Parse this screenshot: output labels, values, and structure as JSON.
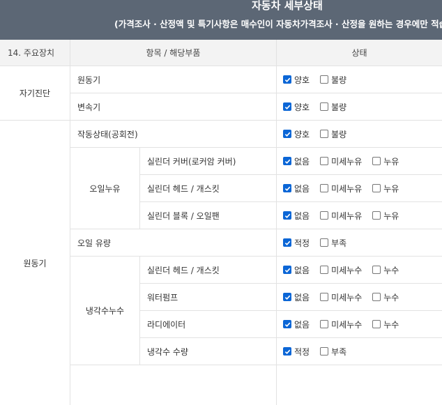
{
  "header": {
    "title": "자동차 세부상태",
    "subtitle": "(가격조사 · 산정액 및 특기사항은 매수인이 자동차가격조사 · 산정을 원하는 경우에만 적습니다"
  },
  "table": {
    "col_section": "14. 주요장치",
    "col_item": "항목 / 해당부품",
    "col_status": "상태",
    "categories": {
      "self_diag": "자기진단",
      "engine": "원동기"
    },
    "subgroups": {
      "oil_leak": "오일누유",
      "coolant_leak": "냉각수누수"
    },
    "rows": [
      {
        "label": "원동기",
        "options": [
          {
            "label": "양호",
            "checked": true
          },
          {
            "label": "불량",
            "checked": false
          }
        ]
      },
      {
        "label": "변속기",
        "options": [
          {
            "label": "양호",
            "checked": true
          },
          {
            "label": "불량",
            "checked": false
          }
        ]
      },
      {
        "label": "작동상태(공회전)",
        "options": [
          {
            "label": "양호",
            "checked": true
          },
          {
            "label": "불량",
            "checked": false
          }
        ]
      },
      {
        "label": "실린더 커버(로커암 커버)",
        "options": [
          {
            "label": "없음",
            "checked": true
          },
          {
            "label": "미세누유",
            "checked": false
          },
          {
            "label": "누유",
            "checked": false
          }
        ]
      },
      {
        "label": "실린더 헤드 / 개스킷",
        "options": [
          {
            "label": "없음",
            "checked": true
          },
          {
            "label": "미세누유",
            "checked": false
          },
          {
            "label": "누유",
            "checked": false
          }
        ]
      },
      {
        "label": "실린더 블록 / 오일팬",
        "options": [
          {
            "label": "없음",
            "checked": true
          },
          {
            "label": "미세누유",
            "checked": false
          },
          {
            "label": "누유",
            "checked": false
          }
        ]
      },
      {
        "label": "오일 유량",
        "options": [
          {
            "label": "적정",
            "checked": true
          },
          {
            "label": "부족",
            "checked": false
          }
        ]
      },
      {
        "label": "실린더 헤드 / 개스킷",
        "options": [
          {
            "label": "없음",
            "checked": true
          },
          {
            "label": "미세누수",
            "checked": false
          },
          {
            "label": "누수",
            "checked": false
          }
        ]
      },
      {
        "label": "워터펌프",
        "options": [
          {
            "label": "없음",
            "checked": true
          },
          {
            "label": "미세누수",
            "checked": false
          },
          {
            "label": "누수",
            "checked": false
          }
        ]
      },
      {
        "label": "라디에이터",
        "options": [
          {
            "label": "없음",
            "checked": true
          },
          {
            "label": "미세누수",
            "checked": false
          },
          {
            "label": "누수",
            "checked": false
          }
        ]
      },
      {
        "label": "냉각수 수량",
        "options": [
          {
            "label": "적정",
            "checked": true
          },
          {
            "label": "부족",
            "checked": false
          }
        ]
      }
    ],
    "icons": {
      "checkbox": "checkbox-icon"
    },
    "colors": {
      "header_bg": "#5c6775",
      "check_blue": "#0b66d6",
      "head_cell_bg": "#f3f3f3"
    }
  }
}
